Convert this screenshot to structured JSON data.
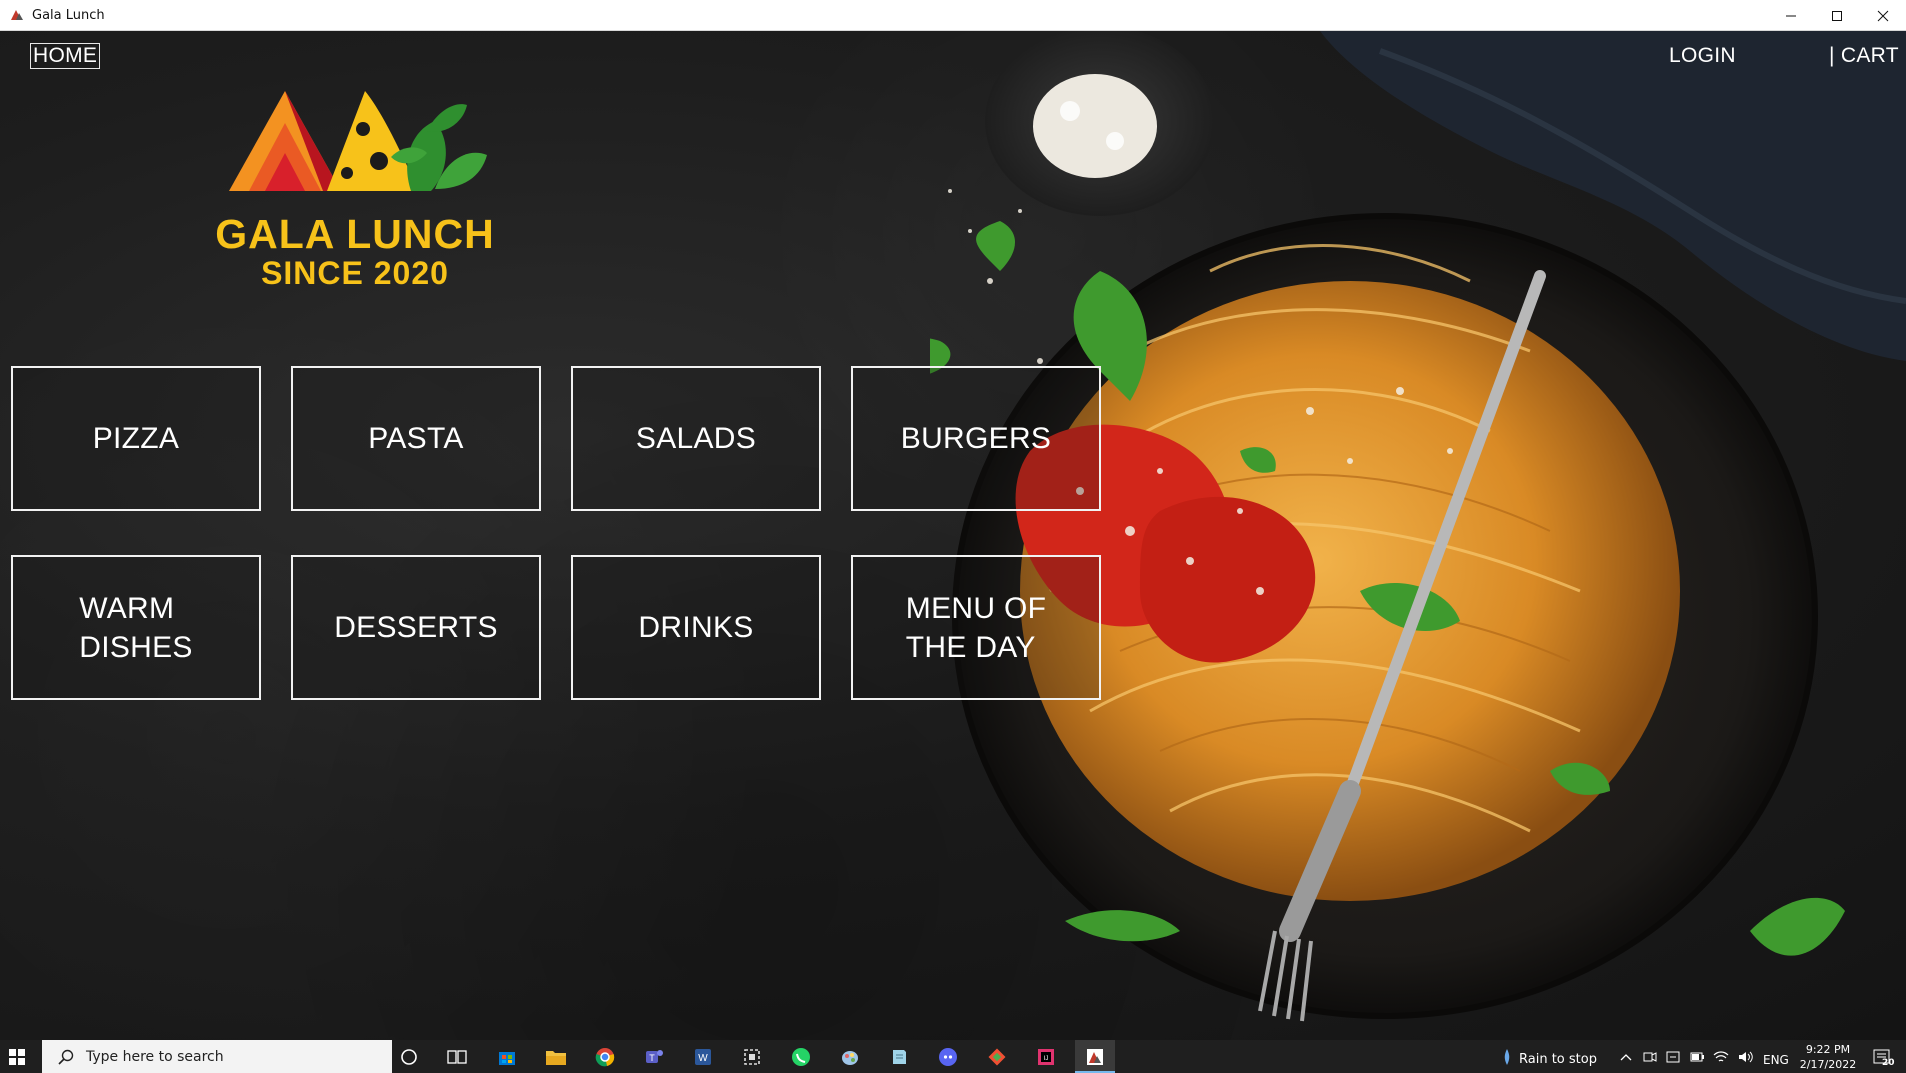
{
  "window": {
    "title": "Gala Lunch",
    "icons": {
      "minimize": "minimize-icon",
      "maximize": "maximize-icon",
      "close": "close-icon"
    }
  },
  "nav": {
    "home": "HOME",
    "login": "LOGIN",
    "cart": "| CART"
  },
  "logo": {
    "line1": "GALA LUNCH",
    "line2": "SINCE 2020",
    "colors": {
      "text": "#f7c21a",
      "triangle_red": "#d8202b",
      "triangle_orange": "#f28c1c",
      "cheese": "#f7c21a",
      "leaf": "#2f8f2f"
    }
  },
  "categories": [
    {
      "label": "PIZZA"
    },
    {
      "label": "PASTA"
    },
    {
      "label": "SALADS"
    },
    {
      "label": "BURGERS"
    },
    {
      "label": "WARM\nDISHES"
    },
    {
      "label": "DESSERTS"
    },
    {
      "label": "DRINKS"
    },
    {
      "label": "MENU OF\nTHE DAY"
    }
  ],
  "taskbar": {
    "search_placeholder": "Type here to search",
    "apps": [
      "cortana-icon",
      "task-view-icon",
      "store-icon",
      "file-explorer-icon",
      "chrome-icon",
      "teams-icon",
      "word-icon",
      "snipping-tool-icon",
      "whatsapp-icon",
      "paint-icon",
      "notepad-icon",
      "discord-icon",
      "git-icon",
      "intellij-icon",
      "gala-lunch-app-icon"
    ],
    "weather": "Rain to stop",
    "language": "ENG",
    "time": "9:22 PM",
    "date": "2/17/2022",
    "notification_count": "20"
  }
}
